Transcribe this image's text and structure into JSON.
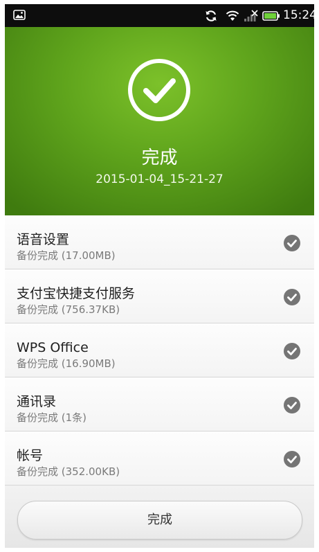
{
  "status_bar": {
    "time": "15:24",
    "icons": [
      "image-icon",
      "sync-icon",
      "wifi-icon",
      "signal-icon",
      "battery-icon"
    ]
  },
  "header": {
    "title": "完成",
    "subtitle": "2015-01-04_15-21-27",
    "icon": "check-circle-icon",
    "colors": {
      "light": "#7cc12a",
      "dark": "#3f7b0f"
    }
  },
  "items": [
    {
      "title": "语音设置",
      "status": "备份完成 (17.00MB)"
    },
    {
      "title": "支付宝快捷支付服务",
      "status": "备份完成 (756.37KB)"
    },
    {
      "title": "WPS Office",
      "status": "备份完成 (16.90MB)"
    },
    {
      "title": "通讯录",
      "status": "备份完成 (1条)"
    },
    {
      "title": "帐号",
      "status": "备份完成 (352.00KB)"
    }
  ],
  "footer": {
    "done_label": "完成"
  }
}
